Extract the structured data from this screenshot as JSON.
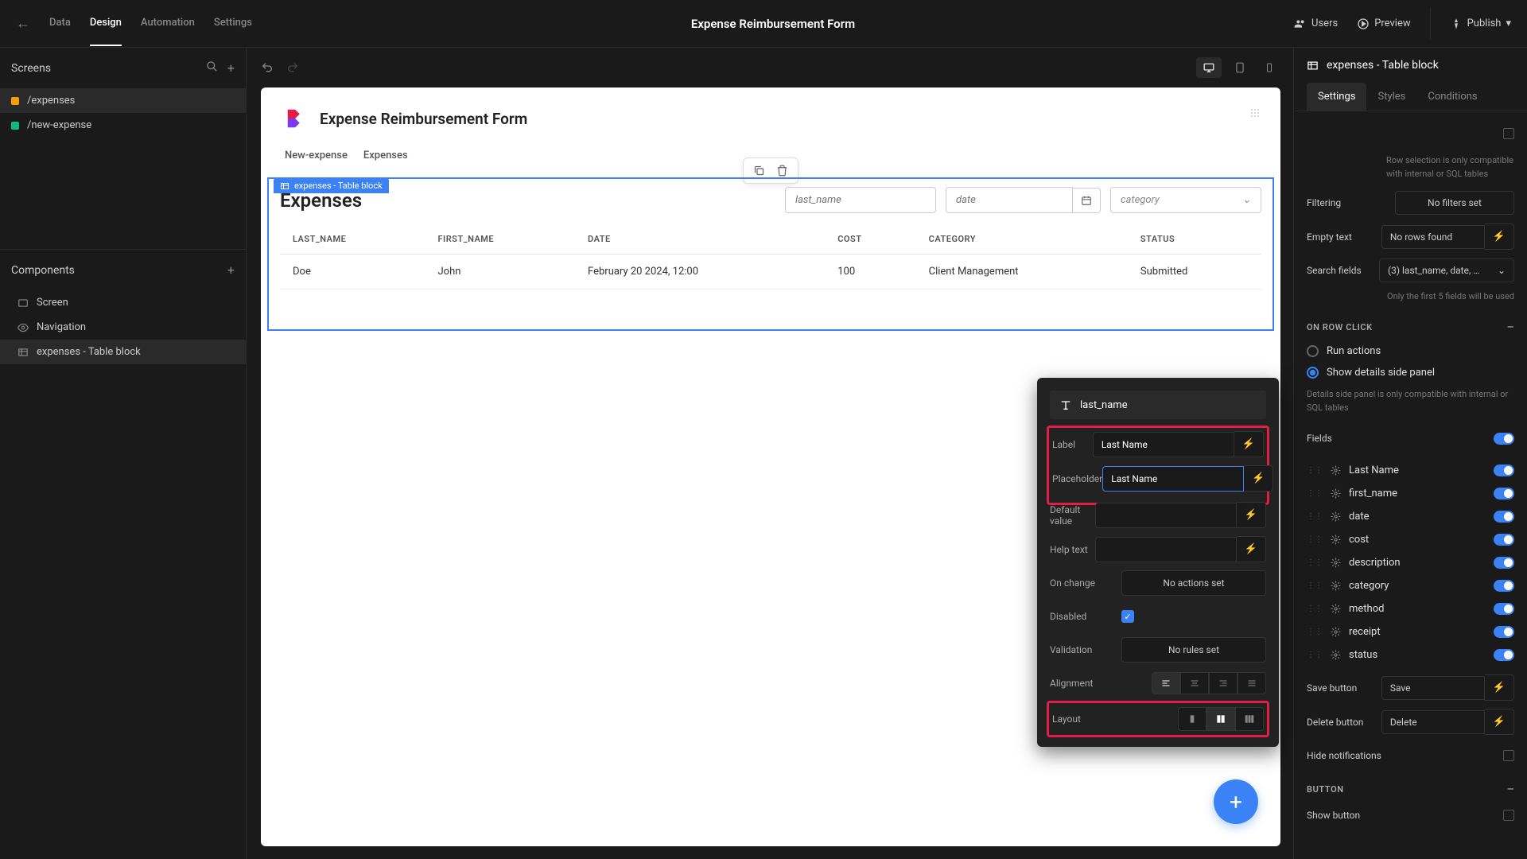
{
  "app_title": "Expense Reimbursement Form",
  "topbar": {
    "tabs": [
      "Data",
      "Design",
      "Automation",
      "Settings"
    ],
    "users": "Users",
    "preview": "Preview",
    "publish": "Publish"
  },
  "left": {
    "screens_header": "Screens",
    "screens": [
      {
        "path": "/expenses",
        "color": "orange"
      },
      {
        "path": "/new-expense",
        "color": "teal"
      }
    ],
    "components_header": "Components",
    "components": [
      {
        "label": "Screen",
        "icon": "screen"
      },
      {
        "label": "Navigation",
        "icon": "eye"
      },
      {
        "label": "expenses - Table block",
        "icon": "table",
        "active": true
      }
    ]
  },
  "canvas": {
    "title": "Expense Reimbursement Form",
    "nav": [
      "New-expense",
      "Expenses"
    ],
    "block_tag": "expenses - Table block",
    "table_title": "Expenses",
    "filters": {
      "last_name_ph": "last_name",
      "date_ph": "date",
      "category_ph": "category"
    },
    "columns": [
      "LAST_NAME",
      "FIRST_NAME",
      "DATE",
      "COST",
      "CATEGORY",
      "STATUS"
    ],
    "rows": [
      {
        "last_name": "Doe",
        "first_name": "John",
        "date": "February 20 2024, 12:00",
        "cost": "100",
        "category": "Client Management",
        "status": "Submitted"
      }
    ]
  },
  "popup": {
    "header": "last_name",
    "rows": {
      "label_lbl": "Label",
      "label_val": "Last Name",
      "placeholder_lbl": "Placeholder",
      "placeholder_val": "Last Name",
      "default_lbl": "Default value",
      "default_val": "",
      "help_lbl": "Help text",
      "help_val": "",
      "onchange_lbl": "On change",
      "onchange_val": "No actions set",
      "disabled_lbl": "Disabled",
      "validation_lbl": "Validation",
      "validation_val": "No rules set",
      "alignment_lbl": "Alignment",
      "layout_lbl": "Layout"
    }
  },
  "rs": {
    "header": "expenses - Table block",
    "tabs": [
      "Settings",
      "Styles",
      "Conditions"
    ],
    "row_sel_note": "Row selection is only compatible with internal or SQL tables",
    "filtering_lbl": "Filtering",
    "filtering_val": "No filters set",
    "empty_lbl": "Empty text",
    "empty_val": "No rows found",
    "search_lbl": "Search fields",
    "search_val": "(3) last_name, date, …",
    "search_note": "Only the first 5 fields will be used",
    "onrowclick": "ON ROW CLICK",
    "radio1": "Run actions",
    "radio2": "Show details side panel",
    "details_note": "Details side panel is only compatible with internal or SQL tables",
    "fields_lbl": "Fields",
    "fields": [
      "Last Name",
      "first_name",
      "date",
      "cost",
      "description",
      "category",
      "method",
      "receipt",
      "status"
    ],
    "save_lbl": "Save button",
    "save_val": "Save",
    "delete_lbl": "Delete button",
    "delete_val": "Delete",
    "hide_notif": "Hide notifications",
    "button_section": "BUTTON",
    "show_button": "Show button"
  }
}
